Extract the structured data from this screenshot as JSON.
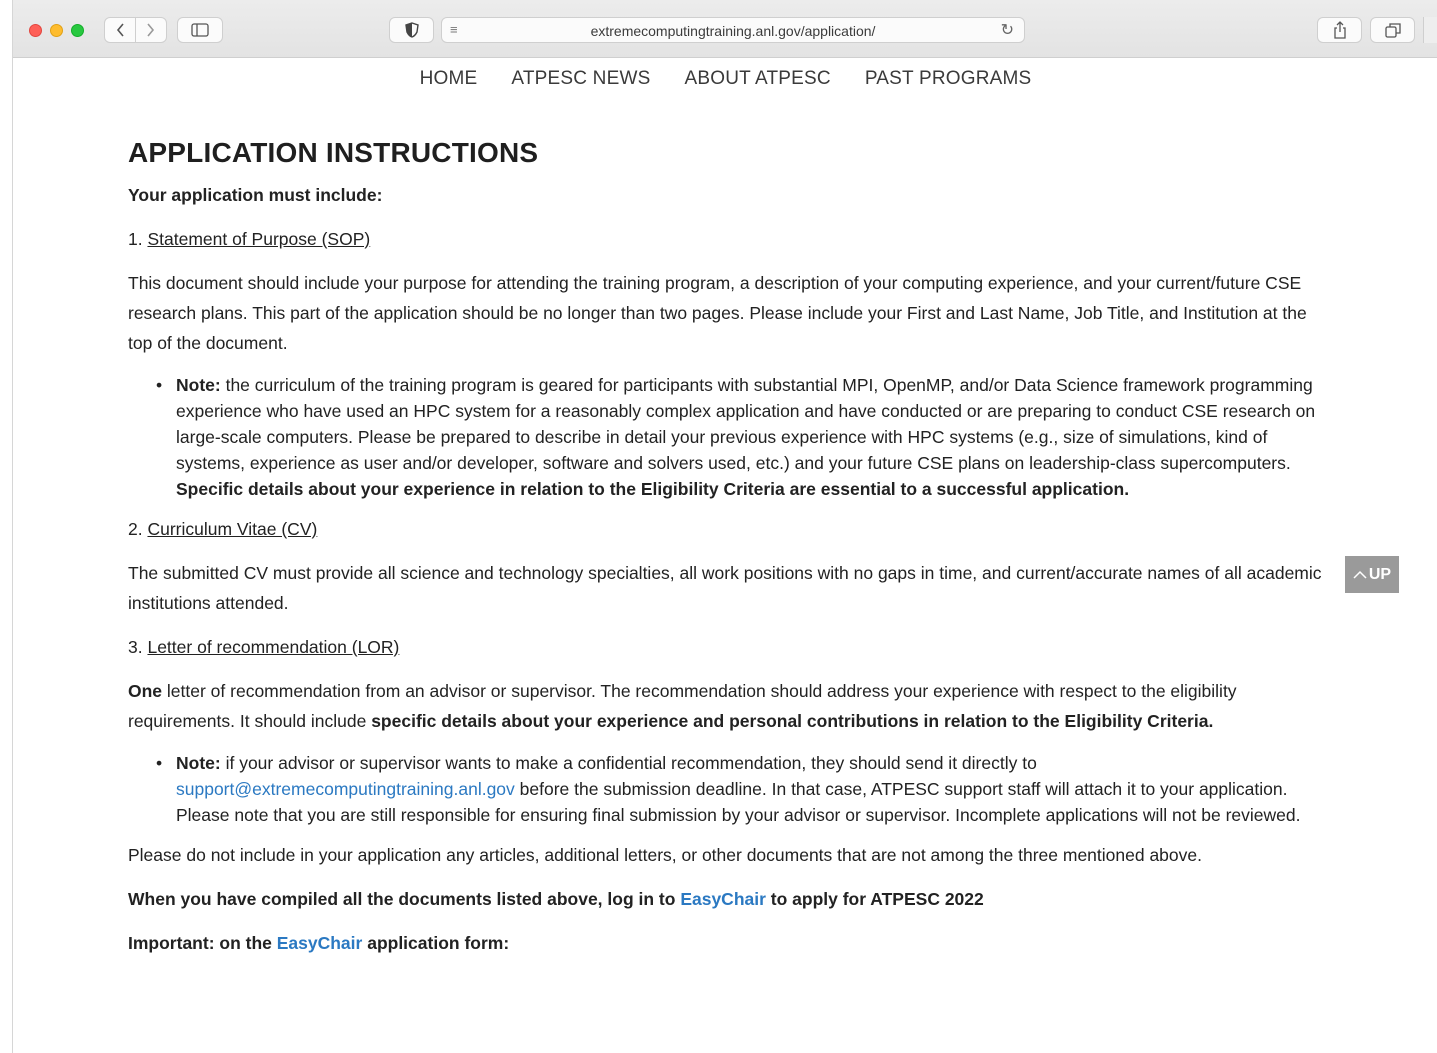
{
  "browser": {
    "url": "extremecomputingtraining.anl.gov/application/"
  },
  "nav": {
    "items": [
      "HOME",
      "ATPESC NEWS",
      "ABOUT ATPESC",
      "PAST PROGRAMS"
    ]
  },
  "page": {
    "title": "APPLICATION INSTRUCTIONS",
    "must_include": "Your application must include:",
    "sop": {
      "number": "1. ",
      "label": "Statement of Purpose (SOP)",
      "text": "This document should include your purpose for attending the training program, a description of your computing experience, and your current/future CSE research plans.  This part of the application should be no longer than two pages.  Please include your First and Last Name, Job Title, and Institution at the top of the document.",
      "note_label": "Note:",
      "note_text": " the curriculum of the training program is geared for participants with substantial MPI, OpenMP, and/or Data Science framework programming experience who have used an HPC system for a reasonably complex application and have conducted or are preparing to conduct CSE research on large-scale computers.  Please be prepared to describe in detail your previous experience with HPC systems (e.g., size of simulations, kind of systems, experience as user and/or developer, software and solvers used, etc.) and your future CSE plans on leadership-class supercomputers.  ",
      "note_bold": "Specific details about your experience in relation to the Eligibility Criteria are essential to a successful application."
    },
    "cv": {
      "number": "2. ",
      "label": "Curriculum Vitae (CV)",
      "text": "The submitted CV must provide all science and technology specialties, all work positions with no gaps in time, and current/accurate names of all academic institutions attended."
    },
    "lor": {
      "number": "3. ",
      "label": "Letter of recommendation (LOR)",
      "one": "One",
      "text": " letter of recommendation from an advisor or supervisor.  The recommendation should address your experience with respect to the eligibility requirements.  It should include ",
      "text_bold": "specific details about your experience and personal contributions in relation to the Eligibility Criteria.",
      "note_label": "Note:",
      "note_text1": " if your advisor or supervisor wants to make a confidential recommendation, they should send it directly to ",
      "note_email": "support@extremecomputingtraining.anl.gov",
      "note_text2": " before the submission deadline.  In that case, ATPESC support staff will attach it to your application.  Please note that you are still responsible for ensuring final submission by your advisor or supervisor.  Incomplete applications will not be reviewed."
    },
    "exclude_text": "Please do not include in your application any articles, additional letters, or other documents that are not among the three mentioned above.",
    "login_pre": "When you have compiled all the documents listed above, log in to ",
    "login_link": "EasyChair",
    "login_post": " to apply for ATPESC 2022",
    "important_pre": "Important: on the ",
    "important_link": "EasyChair",
    "important_post": " application form:"
  },
  "up_button": "UP"
}
